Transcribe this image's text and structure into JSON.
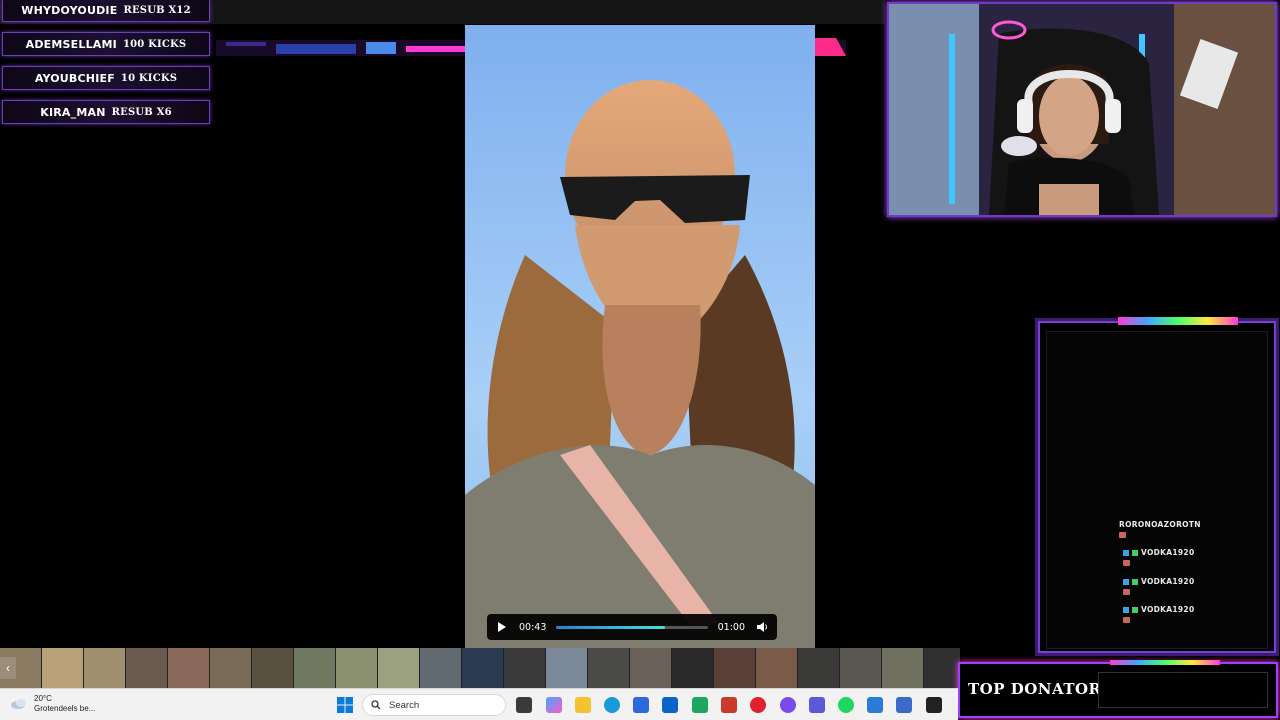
{
  "events": [
    {
      "name": "WHYDOYOUDIE",
      "detail": "RESUB X12"
    },
    {
      "name": "ADEMSELLAMI",
      "detail": "100 KICKS"
    },
    {
      "name": "AYOUBCHIEF",
      "detail": "10 KICKS"
    },
    {
      "name": "KIRA_MAN",
      "detail": "RESUB X6"
    }
  ],
  "player": {
    "current_time": "00:43",
    "duration": "01:00",
    "progress": 0.72
  },
  "chat": [
    {
      "user": "RORONOAZOROTN"
    },
    {
      "user": "VODKA1920"
    },
    {
      "user": "VODKA1920"
    },
    {
      "user": "VODKA1920"
    }
  ],
  "donator": {
    "label": "TOP DONATOR"
  },
  "taskbar": {
    "weather_temp": "20°C",
    "weather_desc": "Grotendeels be...",
    "search_placeholder": "Search"
  },
  "colors": {
    "accent_purple": "#7c3cd8",
    "accent_pink": "#ff3bd2",
    "progress_fill": "#47e0d4"
  }
}
